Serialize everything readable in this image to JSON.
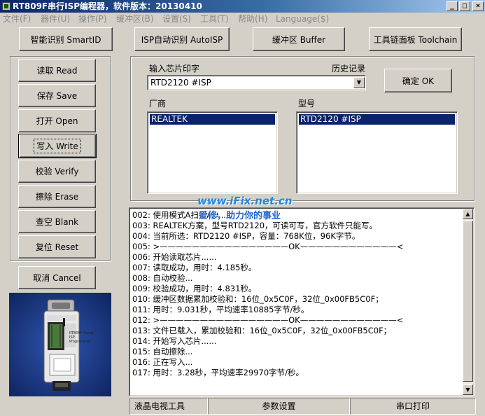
{
  "window": {
    "title": "RT809F串行ISP编程器，软件版本：20130410",
    "min_icon": "minimize-icon",
    "max_icon": "maximize-icon",
    "close_icon": "close-icon"
  },
  "menu": [
    "文件(F)",
    "器件(U)",
    "操作(P)",
    "缓冲区(B)",
    "设置(S)",
    "工具(T)",
    "帮助(H)",
    "Language($)"
  ],
  "toolbar": {
    "smartid": "智能识别 SmartID",
    "autoisp": "ISP自动识别 AutoISP",
    "buffer": "缓冲区 Buffer",
    "toolchain": "工具链面板 Toolchain"
  },
  "ops": {
    "read": "读取 Read",
    "save": "保存 Save",
    "open": "打开 Open",
    "write": "写入 Write",
    "verify": "校验 Verify",
    "erase": "擦除 Erase",
    "blank": "查空 Blank",
    "reset": "复位 Reset",
    "cancel": "取消 Cancel"
  },
  "chip": {
    "input_label": "输入芯片印字",
    "history_label": "历史记录",
    "input_value": "RTD2120 #ISP",
    "ok": "确定 OK",
    "vendor_label": "厂商",
    "model_label": "型号",
    "vendors": [
      "REALTEK"
    ],
    "models": [
      "RTD2120 #ISP"
    ]
  },
  "watermark": {
    "site": "www.iFix.net.cn",
    "slogan": "爱修，助力你的事业"
  },
  "device_image": {
    "label": "RT809F Serial ISP Programmer"
  },
  "log": [
    "002: 使用模式A扫描AD...",
    "003: REALTEK方案，型号RTD2120，可读可写，官方软件只能写。",
    "004: 当前所选：RTD2120 #ISP，容量：768K位，96K字节。",
    "005: >————————————————OK————————————<",
    "006: 开始读取芯片......",
    "007: 读取成功，用时：4.185秒。",
    "008: 自动校验...",
    "009: 校验成功，用时：4.831秒。",
    "010: 缓冲区数据累加校验和：16位_0x5C0F，32位_0x00FB5C0F；",
    "011: 用时：9.031秒，平均速率10885字节/秒。",
    "012: >————————————————OK————————————<",
    "013: 文件已载入，累加校验和：16位_0x5C0F，32位_0x00FB5C0F；",
    "014: 开始写入芯片......",
    "015: 自动擦除...",
    "016: 正在写入...",
    "017: 用时：3.28秒，平均速率29970字节/秒。"
  ],
  "status": {
    "tv_tools": "液晶电视工具",
    "params": "参数设置",
    "serial": "串口打印"
  }
}
